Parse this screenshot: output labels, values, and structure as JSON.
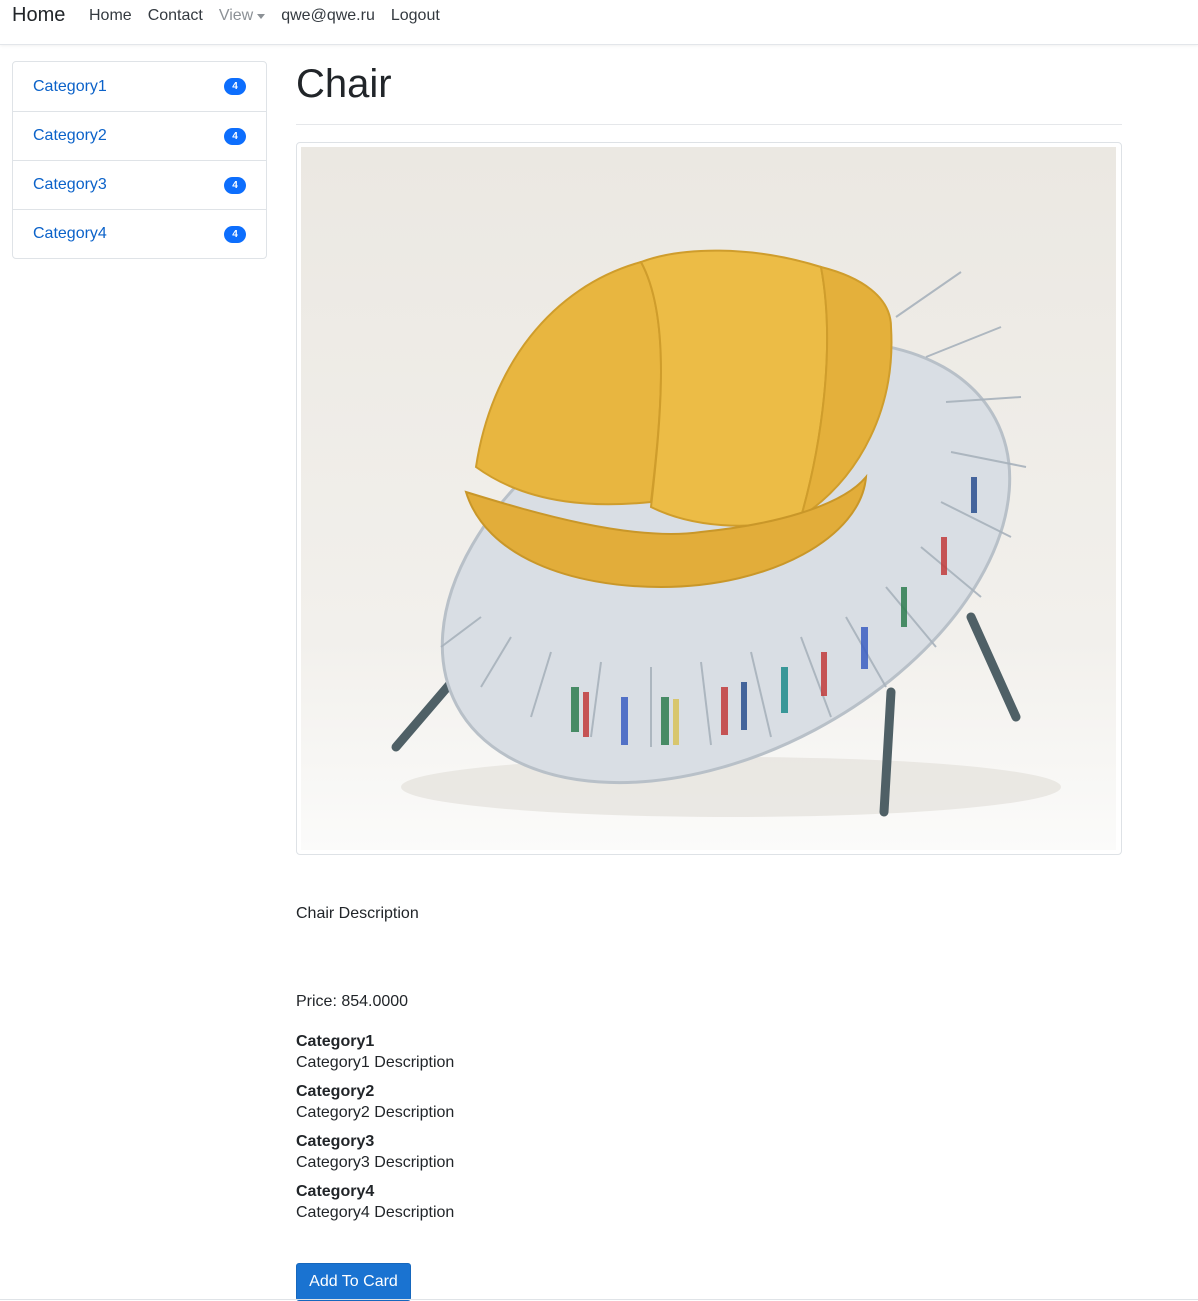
{
  "navbar": {
    "brand": "Home",
    "links": [
      {
        "label": "Home"
      },
      {
        "label": "Contact"
      },
      {
        "label": "View"
      },
      {
        "label": "qwe@qwe.ru"
      },
      {
        "label": "Logout"
      }
    ]
  },
  "sidebar": {
    "items": [
      {
        "label": "Category1",
        "count": "4"
      },
      {
        "label": "Category2",
        "count": "4"
      },
      {
        "label": "Category3",
        "count": "4"
      },
      {
        "label": "Category4",
        "count": "4"
      }
    ]
  },
  "product": {
    "title": "Chair",
    "description": "Chair Description",
    "price": "Price: 854.0000",
    "categories": [
      {
        "name": "Category1",
        "description": "Category1 Description"
      },
      {
        "name": "Category2",
        "description": "Category2 Description"
      },
      {
        "name": "Category3",
        "description": "Category3 Description"
      },
      {
        "name": "Category4",
        "description": "Category4 Description"
      }
    ],
    "add_button": "Add To Card"
  },
  "colors": {
    "accent": "#1a73d1",
    "badge": "#0d6efd",
    "link": "#0b62c9",
    "cushion": "#e8b640"
  }
}
